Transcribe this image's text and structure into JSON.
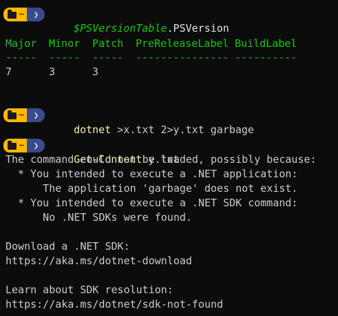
{
  "prompt": {
    "folder_label": "~",
    "arrow_glyph": "❯",
    "folder_icon": "folder-icon",
    "colors": {
      "folder_segment": "#ffb900",
      "arrow_segment": "#3a4b8c",
      "command": "#f9f1a5",
      "variable": "#16c60c"
    }
  },
  "block1": {
    "command_var": "$PSVersionTable",
    "command_rest": ".PSVersion",
    "headers": [
      "Major",
      "Minor",
      "Patch",
      "PreReleaseLabel",
      "BuildLabel"
    ],
    "separators": [
      "-----",
      "-----",
      "-----",
      "---------------",
      "----------"
    ],
    "values": [
      "7",
      "3",
      "3",
      "",
      ""
    ]
  },
  "block2": {
    "command": "dotnet",
    "args": " >x.txt 2>y.txt garbage"
  },
  "block3": {
    "command": "Get-Content",
    "args": " y.txt",
    "output": [
      "The command could not be loaded, possibly because:",
      "  * You intended to execute a .NET application:",
      "      The application 'garbage' does not exist.",
      "  * You intended to execute a .NET SDK command:",
      "      No .NET SDKs were found.",
      "",
      "Download a .NET SDK:",
      "https://aka.ms/dotnet-download",
      "",
      "Learn about SDK resolution:",
      "https://aka.ms/dotnet/sdk-not-found"
    ]
  }
}
